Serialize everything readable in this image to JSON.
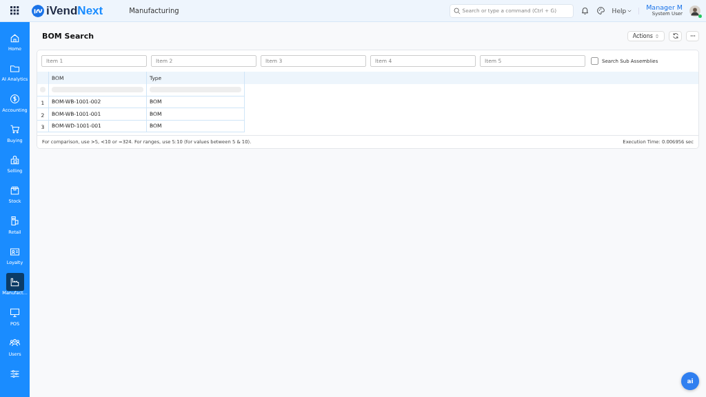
{
  "topbar": {
    "logo_prefix": "iVend",
    "logo_suffix": "Next",
    "module": "Manufacturing",
    "search": {
      "placeholder": "Search or type a command (Ctrl + G)"
    },
    "help": "Help",
    "user": {
      "name": "Manager M",
      "role": "System User",
      "online": true
    }
  },
  "sidebar": {
    "items": [
      {
        "kind": "home",
        "label": "Home",
        "selected": false
      },
      {
        "kind": "folder",
        "label": "AI Analytics",
        "selected": false
      },
      {
        "kind": "dollar",
        "label": "Accounting",
        "selected": false
      },
      {
        "kind": "cart",
        "label": "Buying",
        "selected": false
      },
      {
        "kind": "bag",
        "label": "Selling",
        "selected": false
      },
      {
        "kind": "box",
        "label": "Stock",
        "selected": false
      },
      {
        "kind": "retail",
        "label": "Retail",
        "selected": false
      },
      {
        "kind": "card",
        "label": "Loyalty",
        "selected": false
      },
      {
        "kind": "factory",
        "label": "Manufact...",
        "selected": true
      },
      {
        "kind": "monitor",
        "label": "POS",
        "selected": false
      },
      {
        "kind": "users",
        "label": "Users",
        "selected": false
      },
      {
        "kind": "sliders",
        "selected": false
      }
    ]
  },
  "page": {
    "title": "BOM Search",
    "actions": "Actions"
  },
  "filters": [
    {
      "placeholder": "Item 1"
    },
    {
      "placeholder": "Item 2"
    },
    {
      "placeholder": "Item 3"
    },
    {
      "placeholder": "Item 4"
    },
    {
      "placeholder": "Item 5"
    }
  ],
  "sub_assemblies": {
    "label": "Search Sub Assemblies",
    "checked": false
  },
  "table": {
    "columns": [
      "BOM",
      "Type"
    ],
    "rows": [
      {
        "index": "1",
        "bom": "BOM-WB-1001-002",
        "type": "BOM"
      },
      {
        "index": "2",
        "bom": "BOM-WB-1001-001",
        "type": "BOM"
      },
      {
        "index": "3",
        "bom": "BOM-WD-1001-001",
        "type": "BOM"
      }
    ]
  },
  "footer": {
    "hint": "For comparison, use >5, <10 or =324. For ranges, use 5:10 (for values between 5 & 10).",
    "execution": "Execution Time: 0.006956 sec"
  },
  "assistant": {
    "label": "ai"
  }
}
